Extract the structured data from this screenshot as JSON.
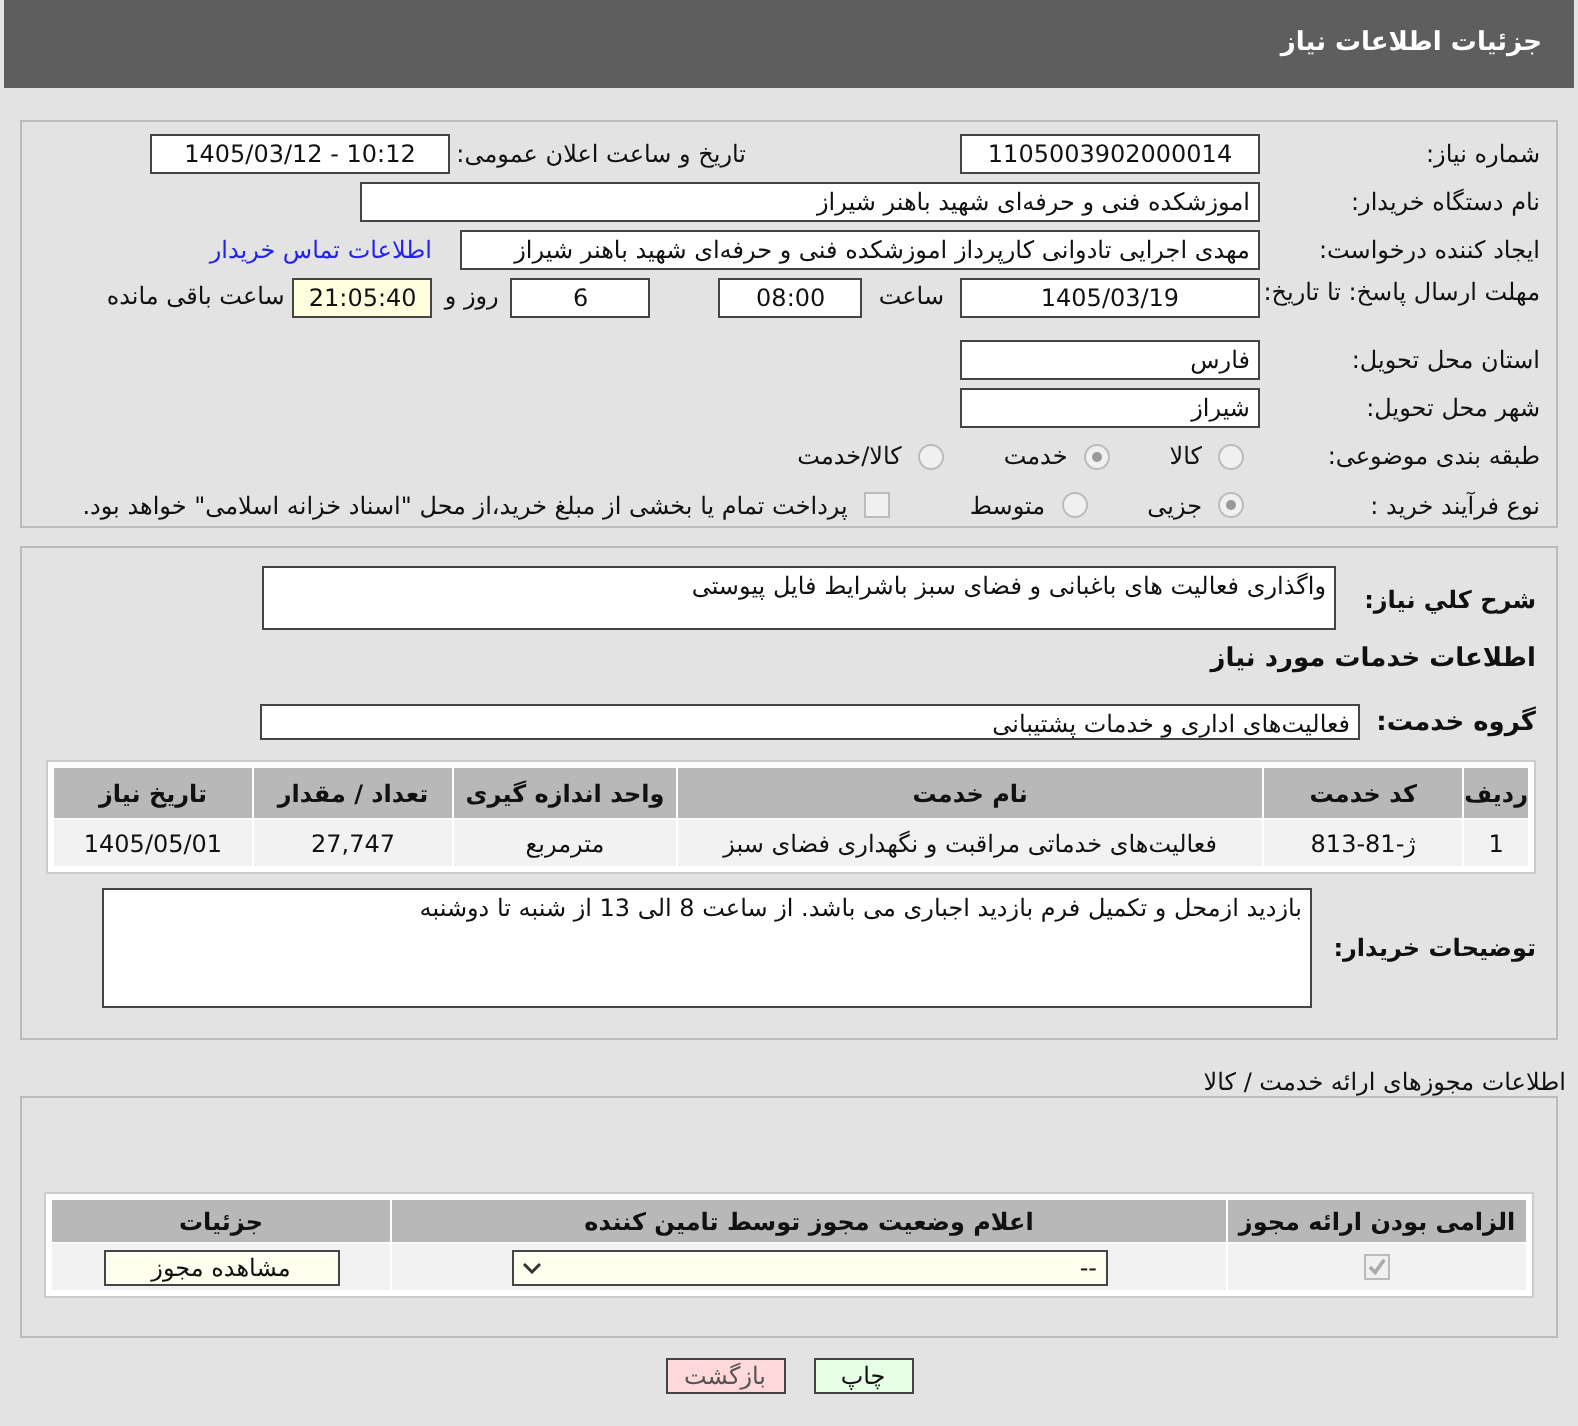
{
  "header": {
    "title": "جزئیات اطلاعات نیاز"
  },
  "need_number": {
    "label": "شماره نیاز:",
    "value": "1105003902000014"
  },
  "announce_datetime": {
    "label": "تاریخ و ساعت اعلان عمومی:",
    "value": "1405/03/12 - 10:12"
  },
  "buyer_org": {
    "label": "نام دستگاه خریدار:",
    "value": "اموزشکده فنی و حرفه‌ای شهید باهنر شیراز"
  },
  "requester": {
    "label": "ایجاد کننده درخواست:",
    "value": "مهدی اجرایی تادوانی کارپرداز اموزشکده فنی و حرفه‌ای شهید باهنر شیراز",
    "contact_link": "اطلاعات تماس خریدار"
  },
  "deadline": {
    "label": "مهلت ارسال پاسخ: تا تاریخ:",
    "date": "1405/03/19",
    "time_label": "ساعت",
    "time": "08:00",
    "days": "6",
    "days_label": "روز و",
    "remaining": "21:05:40",
    "remaining_label": "ساعت باقی مانده"
  },
  "province": {
    "label": "استان محل تحویل:",
    "value": "فارس"
  },
  "city": {
    "label": "شهر محل تحویل:",
    "value": "شیراز"
  },
  "category": {
    "label": "طبقه بندی موضوعی:",
    "options": [
      {
        "label": "کالا",
        "selected": false
      },
      {
        "label": "خدمت",
        "selected": true
      },
      {
        "label": "کالا/خدمت",
        "selected": false
      }
    ]
  },
  "purchase_type": {
    "label": "نوع فرآیند خرید :",
    "options": [
      {
        "label": "جزیی",
        "selected": true
      },
      {
        "label": "متوسط",
        "selected": false
      }
    ],
    "treasury_checkbox": {
      "label": "پرداخت تمام یا بخشی از مبلغ خرید،از محل \"اسناد خزانه اسلامی\" خواهد بود.",
      "checked": false
    }
  },
  "description": {
    "label": "شرح کلي نیاز:",
    "value": "واگذاری فعالیت های باغبانی و فضای سبز  باشرایط فایل پیوستی"
  },
  "services_heading": "اطلاعات خدمات مورد نیاز",
  "service_group": {
    "label": "گروه خدمت:",
    "value": "فعالیت‌های اداری و خدمات پشتیبانی"
  },
  "services_table": {
    "columns": [
      "ردیف",
      "کد خدمت",
      "نام خدمت",
      "واحد اندازه گیری",
      "تعداد / مقدار",
      "تاریخ نیاز"
    ],
    "rows": [
      [
        "1",
        "ژ-81-813",
        "فعالیت‌های خدماتی مراقبت و نگهداری فضای سبز",
        "مترمربع",
        "27,747",
        "1405/05/01"
      ]
    ]
  },
  "buyer_notes": {
    "label": "توضیحات خریدار:",
    "value": "بازدید ازمحل و تکمیل فرم بازدید اجباری می باشد. از ساعت 8 الی 13 از شنبه تا دوشنبه"
  },
  "permits_heading": "اطلاعات مجوزهای ارائه خدمت / کالا",
  "permits_table": {
    "columns": [
      "الزامی بودن ارائه مجوز",
      "اعلام وضعیت مجوز توسط تامین کننده",
      "جزئیات"
    ],
    "rows": [
      {
        "required": true,
        "status": "--",
        "details_button": "مشاهده مجوز"
      }
    ]
  },
  "buttons": [
    {
      "label": "چاپ",
      "kind": "print"
    },
    {
      "label": "بازگشت",
      "kind": "back"
    }
  ]
}
